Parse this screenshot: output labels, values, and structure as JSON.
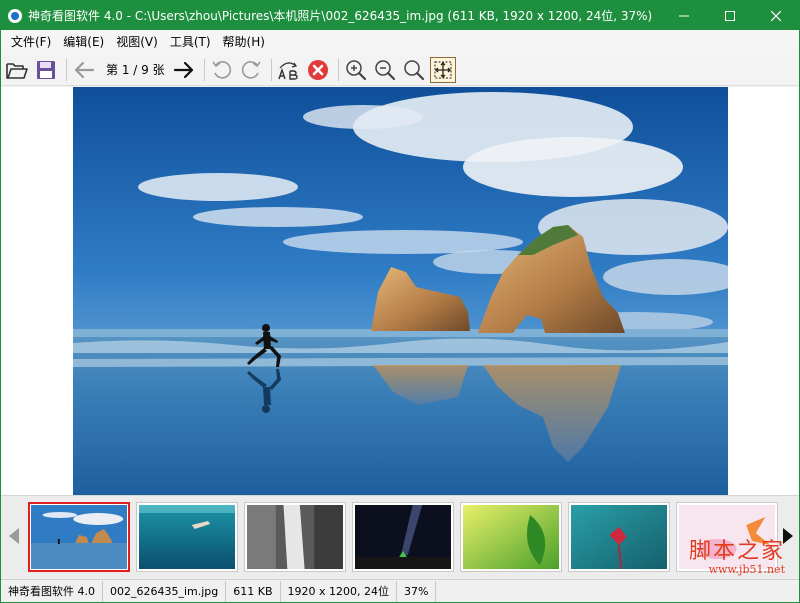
{
  "window": {
    "title": "神奇看图软件 4.0 - C:\\Users\\zhou\\Pictures\\本机照片\\002_626435_im.jpg (611 KB, 1920 x 1200, 24位, 37%)",
    "controls": {
      "minimize": "—",
      "maximize": "☐",
      "close": "✕"
    }
  },
  "menu": [
    {
      "label": "文件(F)"
    },
    {
      "label": "编辑(E)"
    },
    {
      "label": "视图(V)"
    },
    {
      "label": "工具(T)"
    },
    {
      "label": "帮助(H)"
    }
  ],
  "toolbar": {
    "page_indicator": "第 1 / 9 张",
    "icons": [
      "open-folder-icon",
      "save-icon",
      "previous-icon",
      "next-icon",
      "rotate-left-icon",
      "rotate-right-icon",
      "rename-icon",
      "delete-icon",
      "zoom-in-icon",
      "zoom-out-icon",
      "actual-size-icon",
      "fit-window-icon"
    ]
  },
  "thumbnails": {
    "selected_index": 0,
    "items": [
      "beach-rocks",
      "underwater-swimmer",
      "waterfall",
      "night-sky-tent",
      "green-leaf",
      "red-flower",
      "pink-flower"
    ]
  },
  "watermark": {
    "main": "脚本之家",
    "sub": "www.jb51.net"
  },
  "status": {
    "app": "神奇看图软件 4.0",
    "filename": "002_626435_im.jpg",
    "size": "611 KB",
    "dimensions": "1920 x 1200, 24位",
    "zoom": "37%"
  },
  "colors": {
    "titlebar": "#1e8f3e",
    "accent": "#e02020"
  }
}
